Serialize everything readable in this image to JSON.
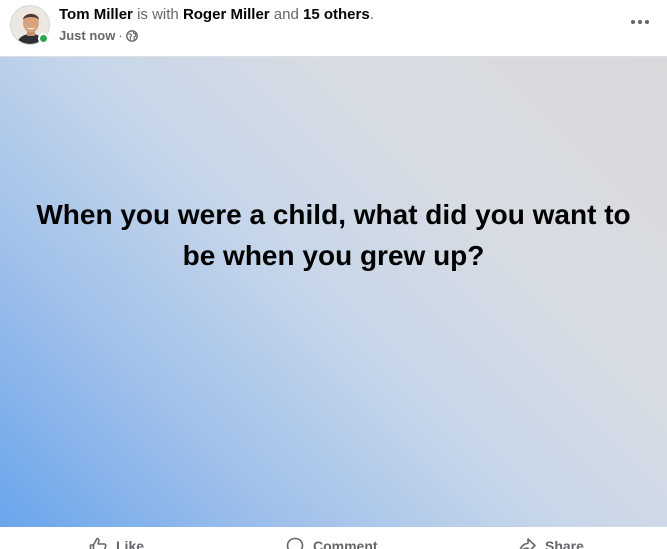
{
  "post": {
    "author": "Tom Miller",
    "with_text": "is with",
    "tagged": "Roger Miller",
    "and_text": "and",
    "others": "15 others",
    "period": ".",
    "time": "Just now",
    "separator": "·",
    "privacy_icon": "globe-icon",
    "more_icon": "more-options-icon",
    "text": "When you were a child, what did you want to be when you grew up?",
    "background_colors": [
      "#6aa5ec",
      "#c6d6ea",
      "#d9d9dc"
    ]
  },
  "actions": [
    {
      "label": "Like",
      "icon": "thumbs-up-icon"
    },
    {
      "label": "Comment",
      "icon": "comment-icon"
    },
    {
      "label": "Share",
      "icon": "share-icon"
    }
  ],
  "colors": {
    "online_status": "#31a24c",
    "secondary_text": "#65676b",
    "primary_text": "#050505"
  }
}
